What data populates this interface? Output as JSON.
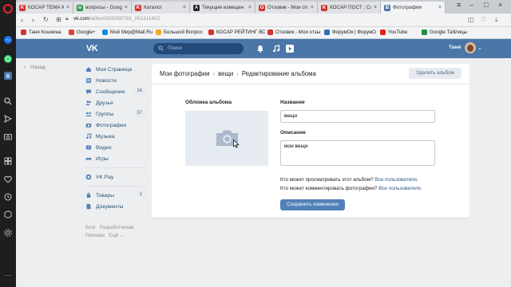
{
  "browser": {
    "tabs": [
      {
        "title": "КОСАР ТЕМА Как с",
        "favicon_color": "#d6322e",
        "favicon_letter": "K"
      },
      {
        "title": "вопросы - Google",
        "favicon_color": "#1e8e3e",
        "favicon_letter": "▤"
      },
      {
        "title": "Каталог",
        "favicon_color": "#d6322e",
        "favicon_letter": "K"
      },
      {
        "title": "Текущие извещен",
        "favicon_color": "#222222",
        "favicon_letter": "A"
      },
      {
        "title": "Отзовик - Мои отз",
        "favicon_color": "#d6322e",
        "favicon_letter": "O"
      },
      {
        "title": "КОСАР ПОСТ : Con",
        "favicon_color": "#d6322e",
        "favicon_letter": "K"
      },
      {
        "title": "Фотографии",
        "favicon_color": "#4a76a8",
        "favicon_letter": "B"
      }
    ],
    "url_host": "vk.com",
    "url_path": "/album505356783_261311402",
    "bookmarks": [
      {
        "label": "Таня Кошкина",
        "favicon_color": "#d6322e"
      },
      {
        "label": "Google+",
        "favicon_color": "#db4437"
      },
      {
        "label": "Мой Мир@Mail.Ru",
        "favicon_color": "#168de2"
      },
      {
        "label": "Большой Вопрос",
        "favicon_color": "#f5a623"
      },
      {
        "label": "КОСАР РЕЙТИНГ ВС",
        "favicon_color": "#d6322e"
      },
      {
        "label": "Отзовик - Мои отзы",
        "favicon_color": "#d6322e"
      },
      {
        "label": "ФорумОк | ФорумО",
        "favicon_color": "#2f6db5"
      },
      {
        "label": "YouTube",
        "favicon_color": "#e62117"
      },
      {
        "label": "Google Таблицы",
        "favicon_color": "#1e8e3e"
      }
    ]
  },
  "vk": {
    "logo": "VK",
    "search_placeholder": "Поиск",
    "user_name": "Таня",
    "back_label": "Назад",
    "menu": [
      {
        "label": "Моя Страница",
        "icon": "home-icon"
      },
      {
        "label": "Новости",
        "icon": "news-icon"
      },
      {
        "label": "Сообщения",
        "icon": "message-icon",
        "badge": "14"
      },
      {
        "label": "Друзья",
        "icon": "friends-icon"
      },
      {
        "label": "Группы",
        "icon": "groups-icon",
        "badge": "37"
      },
      {
        "label": "Фотографии",
        "icon": "photo-icon"
      },
      {
        "label": "Музыка",
        "icon": "music-icon"
      },
      {
        "label": "Видео",
        "icon": "video-icon"
      },
      {
        "label": "Игры",
        "icon": "games-icon"
      }
    ],
    "menu2": [
      {
        "label": "VK Pay",
        "icon": "vkpay-icon"
      }
    ],
    "menu3": [
      {
        "label": "Товары",
        "icon": "goods-icon",
        "badge": "1"
      },
      {
        "label": "Документы",
        "icon": "documents-icon"
      }
    ],
    "footer": {
      "blog": "Блог",
      "developers": "Разработчикам",
      "ads": "Реклама",
      "more": "Ещё ⌄"
    }
  },
  "page": {
    "crumb1": "Мои фотографии",
    "crumb2": "вещи",
    "crumb3": "Редактирование альбома",
    "delete_button": "Удалить альбом",
    "cover_label": "Обложка альбома",
    "name_label": "Название",
    "name_value": "вещи",
    "desc_label": "Описание",
    "desc_value": "мои вещи",
    "view_question": "Кто может просматривать этот альбом?",
    "view_answer": "Все пользователи.",
    "comment_question": "Кто может комментировать фотографии?",
    "comment_answer": "Все пользователи.",
    "save_button": "Сохранить изменения"
  }
}
